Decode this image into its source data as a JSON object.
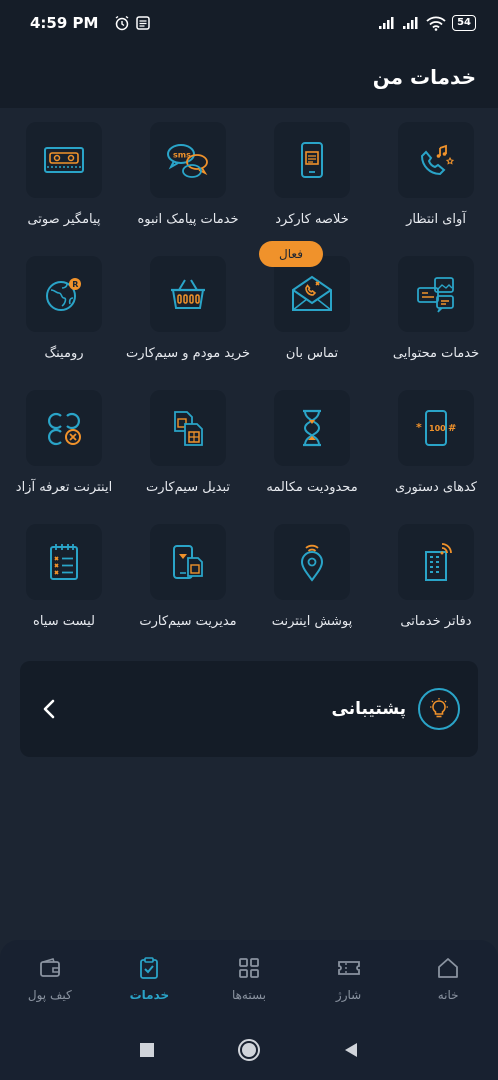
{
  "status_bar": {
    "time": "4:59 PM",
    "battery": "54"
  },
  "header": {
    "title": "خدمات من"
  },
  "services": [
    {
      "label": "آوای انتظار",
      "icon": "music-phone-icon"
    },
    {
      "label": "خلاصه کارکرد",
      "icon": "phone-summary-icon"
    },
    {
      "label": "خدمات پیامک انبوه",
      "icon": "sms-bubbles-icon"
    },
    {
      "label": "پیامگیر صوتی",
      "icon": "cassette-icon"
    },
    {
      "label": "خدمات محتوایی",
      "icon": "content-icon"
    },
    {
      "label": "تماس بان",
      "icon": "call-envelope-icon",
      "badge": "فعال"
    },
    {
      "label": "خرید مودم و سیم‌کارت",
      "icon": "basket-icon"
    },
    {
      "label": "رومینگ",
      "icon": "globe-roaming-icon"
    },
    {
      "label": "کدهای دستوری",
      "icon": "ussd-phone-icon"
    },
    {
      "label": "محدودیت مکالمه",
      "icon": "hourglass-icon"
    },
    {
      "label": "تبدیل سیم‌کارت",
      "icon": "sim-convert-icon"
    },
    {
      "label": "اینترنت تعرفه آزاد",
      "icon": "free-internet-icon"
    },
    {
      "label": "دفاتر خدماتی",
      "icon": "office-building-icon"
    },
    {
      "label": "پوشش اینترنت",
      "icon": "coverage-pin-icon"
    },
    {
      "label": "مدیریت سیم‌کارت",
      "icon": "sim-manage-icon"
    },
    {
      "label": "لیست سیاه",
      "icon": "blacklist-icon"
    }
  ],
  "support": {
    "label": "پشتیبانی",
    "icon": "lightbulb-icon"
  },
  "bottom_nav": [
    {
      "label": "کیف پول",
      "icon": "wallet-icon"
    },
    {
      "label": "خدمات",
      "icon": "clipboard-check-icon",
      "active": true
    },
    {
      "label": "بسته‌ها",
      "icon": "grid-icon"
    },
    {
      "label": "شارژ",
      "icon": "ticket-icon"
    },
    {
      "label": "خانه",
      "icon": "home-icon"
    }
  ],
  "colors": {
    "accent": "#2aa4c8",
    "highlight": "#f0922b",
    "background": "#1c2532"
  }
}
